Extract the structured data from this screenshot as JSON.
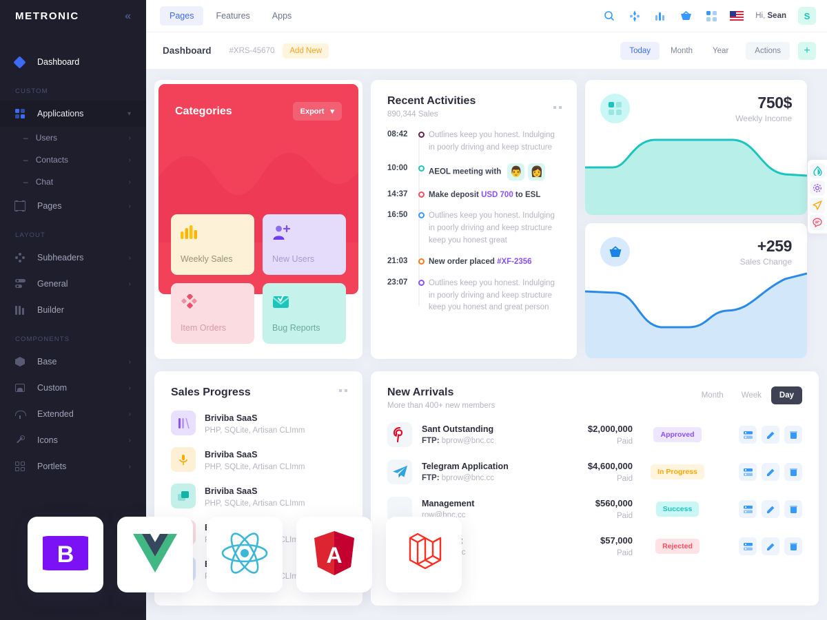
{
  "sidebar": {
    "brand": "METRONIC",
    "collapse_icon": "chevron-double-left-icon",
    "dashboard": {
      "label": "Dashboard",
      "icon": "diamond-icon"
    },
    "sections": [
      {
        "title": "CUSTOM",
        "items": [
          {
            "label": "Applications",
            "icon": "grid-icon",
            "chevron": "chevron-down-icon",
            "active": true
          },
          {
            "label": "Users",
            "sub": true,
            "chevron": "chevron-right-icon"
          },
          {
            "label": "Contacts",
            "sub": true,
            "chevron": "chevron-right-icon"
          },
          {
            "label": "Chat",
            "sub": true,
            "chevron": "chevron-right-icon"
          },
          {
            "label": "Pages",
            "icon": "bracket-icon",
            "chevron": "chevron-right-icon"
          }
        ]
      },
      {
        "title": "LAYOUT",
        "items": [
          {
            "label": "Subheaders",
            "icon": "dots-icon",
            "chevron": "chevron-right-icon"
          },
          {
            "label": "General",
            "icon": "toggle-icon",
            "chevron": "chevron-right-icon"
          },
          {
            "label": "Builder",
            "icon": "bars-icon",
            "chevron": ""
          }
        ]
      },
      {
        "title": "COMPONENTS",
        "items": [
          {
            "label": "Base",
            "icon": "cube-icon",
            "chevron": "chevron-right-icon"
          },
          {
            "label": "Custom",
            "icon": "image-icon",
            "chevron": "chevron-right-icon"
          },
          {
            "label": "Extended",
            "icon": "umbrella-icon",
            "chevron": "chevron-right-icon"
          },
          {
            "label": "Icons",
            "icon": "pen-icon",
            "chevron": "chevron-right-icon"
          },
          {
            "label": "Portlets",
            "icon": "portlet-icon",
            "chevron": "chevron-right-icon"
          }
        ]
      }
    ]
  },
  "header": {
    "tabs": [
      {
        "label": "Pages",
        "active": true
      },
      {
        "label": "Features",
        "active": false
      },
      {
        "label": "Apps",
        "active": false
      }
    ],
    "icons": [
      "search-icon",
      "sparkle-icon",
      "bar-chart-icon",
      "basket-icon",
      "grid-squares-icon",
      "us-flag-icon"
    ],
    "greeting_prefix": "Hi,",
    "greeting_name": "Sean",
    "avatar_initial": "S"
  },
  "subheader": {
    "title": "Dashboard",
    "code": "#XRS-45670",
    "add_new": "Add New",
    "filters": [
      {
        "label": "Today",
        "active": true
      },
      {
        "label": "Month",
        "active": false
      },
      {
        "label": "Year",
        "active": false
      }
    ],
    "actions_label": "Actions",
    "plus_icon": "plus-icon"
  },
  "categories": {
    "title": "Categories",
    "export_label": "Export",
    "export_chevron": "chevron-down-icon",
    "tiles": [
      {
        "label": "Weekly Sales",
        "icon": "bar-chart-icon",
        "color": "yellow"
      },
      {
        "label": "New Users",
        "icon": "user-plus-icon",
        "color": "purple"
      },
      {
        "label": "Item Orders",
        "icon": "diamonds-icon",
        "color": "pink"
      },
      {
        "label": "Bug Reports",
        "icon": "mail-check-icon",
        "color": "teal"
      }
    ]
  },
  "activities": {
    "title": "Recent Activities",
    "subtitle": "890,344 Sales",
    "menu_icon": "dots-menu-icon",
    "items": [
      {
        "time": "08:42",
        "color": "#6b1f4d",
        "text": "Outlines keep you honest. Indulging in poorly driving and keep structure",
        "bold": false
      },
      {
        "time": "10:00",
        "color": "#1bc5bd",
        "text": "AEOL meeting with",
        "bold": true,
        "avatars": [
          "👨",
          "👩"
        ]
      },
      {
        "time": "14:37",
        "color": "#f64e60",
        "bold": true,
        "prefix": "Make deposit ",
        "highlight": "USD 700",
        "suffix": " to ESL"
      },
      {
        "time": "16:50",
        "color": "#3699ff",
        "bold": false,
        "text": "Outlines keep you honest. Indulging in poorly driving and keep structure keep you honest great"
      },
      {
        "time": "21:03",
        "color": "#ff7a1a",
        "bold": true,
        "prefix": "New order placed ",
        "highlight": "#XF-2356",
        "suffix": ""
      },
      {
        "time": "23:07",
        "color": "#8950fc",
        "bold": false,
        "text": "Outlines keep you honest. Indulging in poorly driving and keep structure keep you honest and great person"
      }
    ]
  },
  "stats": [
    {
      "value": "750$",
      "label": "Weekly Income",
      "icon": "grid-squares-icon",
      "icon_bg": "#c9f7f5",
      "icon_color": "#1bc5bd",
      "chart_color": "#1bc5bd",
      "chart_fill": "#b8efe9"
    },
    {
      "value": "+259",
      "label": "Sales Change",
      "icon": "basket-icon",
      "icon_bg": "#d7e9fd",
      "icon_color": "#1b84e7",
      "chart_color": "#2a8ae8",
      "chart_fill": "#d3e7fb"
    }
  ],
  "float_tools": [
    {
      "icon": "droplet-icon",
      "color": "#1bc5bd"
    },
    {
      "icon": "gear-icon",
      "color": "#8950fc"
    },
    {
      "icon": "send-icon",
      "color": "#ffa800"
    },
    {
      "icon": "chat-icon",
      "color": "#f64e60"
    }
  ],
  "sales_progress": {
    "title": "Sales Progress",
    "menu_icon": "dots-menu-icon",
    "items": [
      {
        "name": "Briviba SaaS",
        "desc": "PHP, SQLite, Artisan CLImm",
        "icon": "columns-icon",
        "bg": "#e8e0fd",
        "color": "#8950fc"
      },
      {
        "name": "Briviba SaaS",
        "desc": "PHP, SQLite, Artisan CLImm",
        "icon": "mic-icon",
        "bg": "#fdf0d4",
        "color": "#ffa800"
      },
      {
        "name": "Briviba SaaS",
        "desc": "PHP, SQLite, Artisan CLImm",
        "icon": "chat-square-icon",
        "bg": "#c3f1ea",
        "color": "#1bc5bd"
      },
      {
        "name": "Briviba SaaS",
        "desc": "PHP, SQLite, Artisan CLImm",
        "icon": "heart-icon",
        "bg": "#fbdde1",
        "color": "#f64e60"
      },
      {
        "name": "Briviba SaaS",
        "desc": "PHP, SQLite, Artisan CLImm",
        "icon": "layers-icon",
        "bg": "#d7e2fb",
        "color": "#3699ff"
      }
    ]
  },
  "new_arrivals": {
    "title": "New Arrivals",
    "subtitle": "More than 400+ new members",
    "toggles": [
      {
        "label": "Month",
        "active": false
      },
      {
        "label": "Week",
        "active": false
      },
      {
        "label": "Day",
        "active": true
      }
    ],
    "ftp_label": "FTP:",
    "paid_label": "Paid",
    "action_icons": [
      "list-icon",
      "edit-icon",
      "delete-icon"
    ],
    "rows": [
      {
        "logo": "pinterest-icon",
        "title": "Sant Outstanding",
        "ftp_value": "bprow@bnc.cc",
        "amount": "$2,000,000",
        "paid": "Paid",
        "status": "Approved",
        "status_class": "approved"
      },
      {
        "logo": "telegram-icon",
        "title": "Telegram Application",
        "ftp_value": "bprow@bnc.cc",
        "amount": "$4,600,000",
        "paid": "Paid",
        "status": "In Progress",
        "status_class": "progress"
      },
      {
        "logo": "app-icon",
        "title": "Management",
        "ftp_value": "row@bnc.cc",
        "amount": "$560,000",
        "paid": "Paid",
        "status": "Success",
        "status_class": "success"
      },
      {
        "logo": "app-icon",
        "title": "nagement",
        "ftp_value": "row@bnc.cc",
        "amount": "$57,000",
        "paid": "Paid",
        "status": "Rejected",
        "status_class": "rejected"
      }
    ]
  },
  "framework_cards": [
    {
      "name": "bootstrap-logo"
    },
    {
      "name": "vue-logo"
    },
    {
      "name": "react-logo"
    },
    {
      "name": "angular-logo"
    },
    {
      "name": "laravel-logo"
    }
  ]
}
